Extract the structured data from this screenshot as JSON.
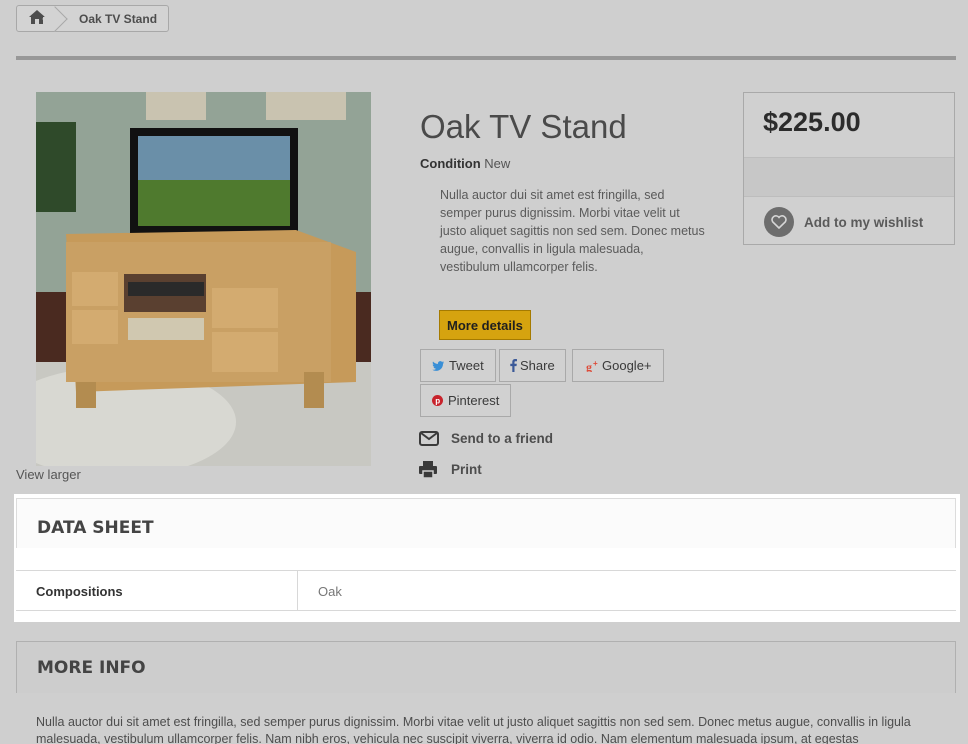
{
  "breadcrumb": {
    "home_icon": "home-icon",
    "current": "Oak TV Stand"
  },
  "product": {
    "title": "Oak TV Stand",
    "condition_label": "Condition",
    "condition_value": "New",
    "description": "Nulla auctor dui sit amet est fringilla, sed semper purus dignissim. Morbi vitae velit ut justo aliquet sagittis non sed sem. Donec metus augue, convallis in ligula malesuada, vestibulum ullamcorper felis.",
    "view_larger": "View larger",
    "more_details": "More details",
    "price": "$225.00",
    "wishlist": "Add to my wishlist"
  },
  "social": {
    "tweet": "Tweet",
    "share": "Share",
    "google": "Google+",
    "pinterest": "Pinterest"
  },
  "actions": {
    "send": "Send to a friend",
    "print": "Print"
  },
  "datasheet": {
    "title": "DATA SHEET",
    "rows": [
      {
        "key": "Compositions",
        "value": "Oak"
      }
    ]
  },
  "moreinfo": {
    "title": "MORE INFO",
    "text": "Nulla auctor dui sit amet est fringilla, sed semper purus dignissim. Morbi vitae velit ut justo aliquet sagittis non sed sem. Donec metus augue, convallis in ligula malesuada, vestibulum ullamcorper felis. Nam nibh eros, vehicula nec suscipit viverra, viverra id odio. Nam elementum malesuada ipsum, at egestas"
  },
  "colors": {
    "accent": "#d6a30f",
    "twitter": "#3a8fd6",
    "facebook": "#3b5998",
    "google": "#dd4b39",
    "pinterest": "#c8232c"
  }
}
